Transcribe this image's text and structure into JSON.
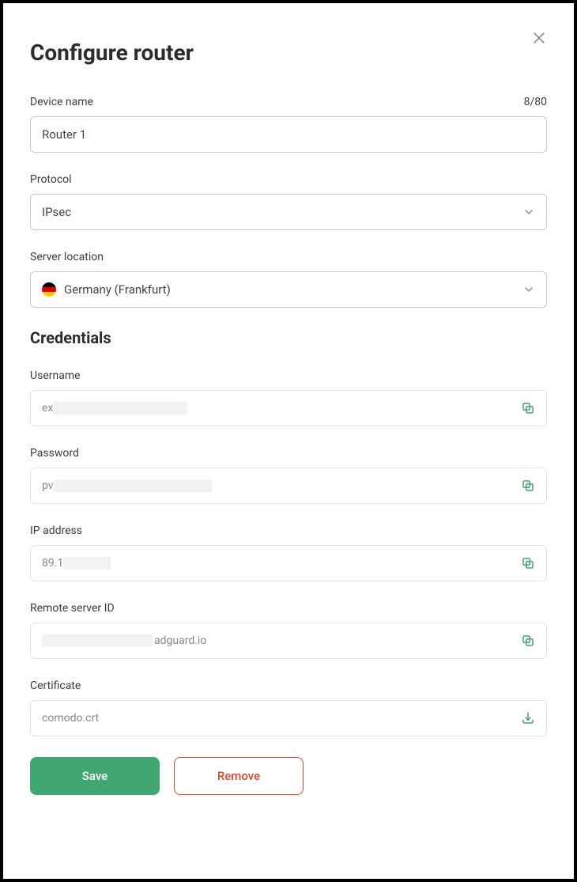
{
  "header": {
    "title": "Configure router"
  },
  "device": {
    "label": "Device name",
    "counter": "8/80",
    "value": "Router 1"
  },
  "protocol": {
    "label": "Protocol",
    "value": "IPsec"
  },
  "location": {
    "label": "Server location",
    "value": "Germany (Frankfurt)"
  },
  "credentials": {
    "title": "Credentials",
    "username": {
      "label": "Username",
      "prefix": "ex"
    },
    "password": {
      "label": "Password",
      "prefix": "pv"
    },
    "ip": {
      "label": "IP address",
      "prefix": "89.1"
    },
    "remote": {
      "label": "Remote server ID",
      "suffix": "adguard.io"
    },
    "cert": {
      "label": "Certificate",
      "value": "comodo.crt"
    }
  },
  "actions": {
    "save": "Save",
    "remove": "Remove"
  }
}
